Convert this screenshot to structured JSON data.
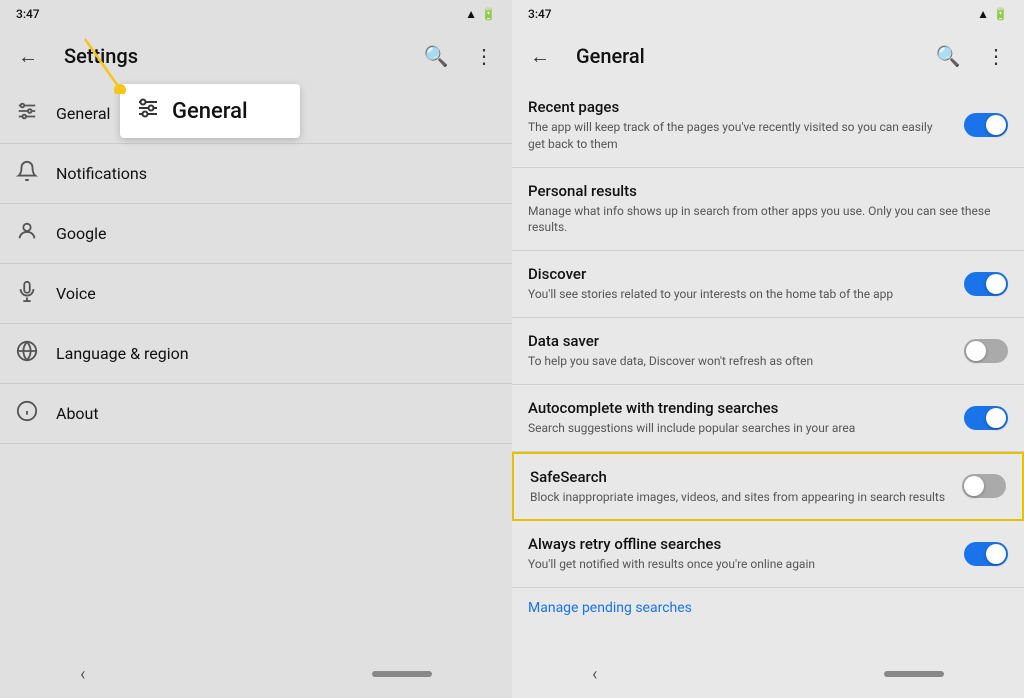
{
  "left_panel": {
    "status_bar": {
      "time": "3:47",
      "icons": "📷 🌐 •"
    },
    "toolbar": {
      "title": "Settings",
      "back_label": "←",
      "search_label": "🔍",
      "more_label": "⋮"
    },
    "menu_items": [
      {
        "id": "general",
        "label": "General",
        "icon": "sliders"
      },
      {
        "id": "notifications",
        "label": "Notifications",
        "icon": "bell"
      },
      {
        "id": "google",
        "label": "Google",
        "icon": "account"
      },
      {
        "id": "voice",
        "label": "Voice",
        "icon": "mic"
      },
      {
        "id": "language",
        "label": "Language & region",
        "icon": "globe"
      },
      {
        "id": "about",
        "label": "About",
        "icon": "info"
      }
    ],
    "callout": {
      "icon": "sliders",
      "label": "General"
    }
  },
  "right_panel": {
    "status_bar": {
      "time": "3:47",
      "icons": "📷 🌐 •"
    },
    "toolbar": {
      "title": "General",
      "back_label": "←",
      "search_label": "🔍",
      "more_label": "⋮"
    },
    "settings": [
      {
        "id": "recent_pages",
        "title": "Recent pages",
        "description": "The app will keep track of the pages you've recently visited so you can easily get back to them",
        "toggle": "on",
        "highlighted": false
      },
      {
        "id": "personal_results",
        "title": "Personal results",
        "description": "Manage what info shows up in search from other apps you use. Only you can see these results.",
        "toggle": null,
        "highlighted": false
      },
      {
        "id": "discover",
        "title": "Discover",
        "description": "You'll see stories related to your interests on the home tab of the app",
        "toggle": "on",
        "highlighted": false
      },
      {
        "id": "data_saver",
        "title": "Data saver",
        "description": "To help you save data, Discover won't refresh as often",
        "toggle": "off",
        "highlighted": false
      },
      {
        "id": "autocomplete",
        "title": "Autocomplete with trending searches",
        "description": "Search suggestions will include popular searches in your area",
        "toggle": "on",
        "highlighted": false
      },
      {
        "id": "safesearch",
        "title": "SafeSearch",
        "description": "Block inappropriate images, videos, and sites from appearing in search results",
        "toggle": "off",
        "highlighted": true
      },
      {
        "id": "retry_offline",
        "title": "Always retry offline searches",
        "description": "You'll get notified with results once you're online again",
        "toggle": "on",
        "highlighted": false
      }
    ],
    "manage_link": "Manage pending searches"
  }
}
